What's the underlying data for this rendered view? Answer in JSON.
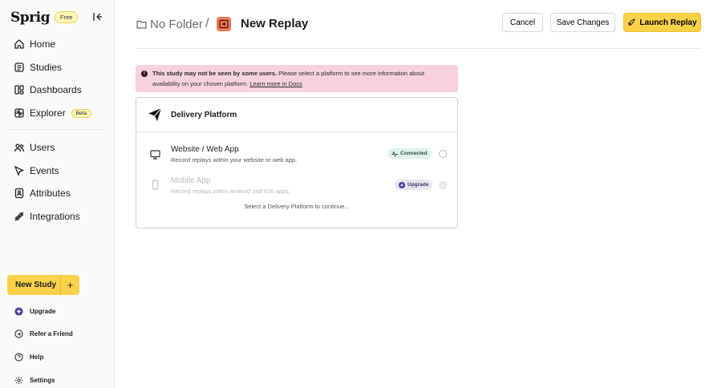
{
  "brand": {
    "logo": "Sprig",
    "plan_badge": "Free"
  },
  "sidebar": {
    "items": [
      {
        "label": "Home",
        "icon": "home-icon"
      },
      {
        "label": "Studies",
        "icon": "studies-icon"
      },
      {
        "label": "Dashboards",
        "icon": "dashboards-icon"
      },
      {
        "label": "Explorer",
        "icon": "explorer-icon",
        "badge": "Beta"
      },
      {
        "label": "Users",
        "icon": "users-icon"
      },
      {
        "label": "Events",
        "icon": "events-icon"
      },
      {
        "label": "Attributes",
        "icon": "attributes-icon"
      },
      {
        "label": "Integrations",
        "icon": "integrations-icon"
      }
    ],
    "new_study_label": "New Study",
    "new_study_plus": "+",
    "footer": [
      {
        "label": "Upgrade",
        "icon": "upgrade-icon"
      },
      {
        "label": "Refer a Friend",
        "icon": "refer-icon"
      },
      {
        "label": "Help",
        "icon": "help-icon"
      },
      {
        "label": "Settings",
        "icon": "settings-icon"
      }
    ]
  },
  "header": {
    "folder": "No Folder",
    "separator": "/",
    "title": "New Replay",
    "cancel_label": "Cancel",
    "save_label": "Save Changes",
    "launch_label": "Launch Replay"
  },
  "alert": {
    "icon_text": "!",
    "bold": "This study may not be seen by some users.",
    "text": " Please select a platform to see more information about availability on your chosen platform. ",
    "link": "Learn more in Docs"
  },
  "delivery": {
    "title": "Delivery Platform",
    "options": [
      {
        "title": "Website / Web App",
        "desc": "Record replays within your website or web app.",
        "badge": "Connected",
        "enabled": true
      },
      {
        "title": "Mobile App",
        "desc": "Record replays within Android and iOS apps.",
        "badge": "Upgrade",
        "enabled": false
      }
    ],
    "hint": "Select a Delivery Platform to continue..."
  },
  "colors": {
    "accent": "#f9d24a",
    "alert_bg": "#f6d2dc",
    "replay_icon": "#f07a57",
    "connected_bg": "#def1ea"
  }
}
